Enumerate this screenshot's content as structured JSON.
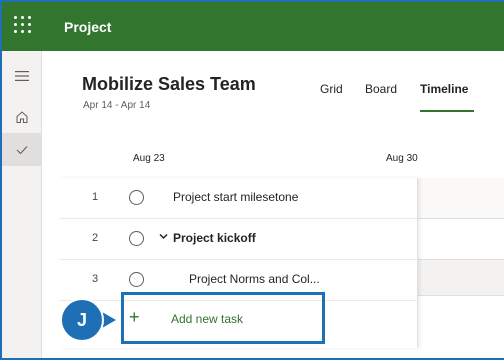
{
  "app": {
    "title": "Project"
  },
  "rail": {
    "icons": [
      "menu-icon",
      "home-icon",
      "check-icon"
    ]
  },
  "plan": {
    "title": "Mobilize Sales Team",
    "dates": "Apr 14 - Apr 14"
  },
  "tabs": [
    {
      "label": "Grid",
      "active": false
    },
    {
      "label": "Board",
      "active": false
    },
    {
      "label": "Timeline",
      "active": true
    }
  ],
  "timeline": {
    "dates": [
      "Aug 23",
      "Aug 30"
    ]
  },
  "tasks": [
    {
      "num": "1",
      "name": "Project start milesetone",
      "bold": false,
      "collapsible": false
    },
    {
      "num": "2",
      "name": "Project kickoff",
      "bold": true,
      "collapsible": true
    },
    {
      "num": "3",
      "name": "Project Norms and Col...",
      "bold": false,
      "collapsible": false
    }
  ],
  "add_task": {
    "label": "Add new task",
    "plus": "+"
  },
  "callout": {
    "letter": "J"
  },
  "colors": {
    "brand": "#31752f",
    "callout": "#1f6fb7"
  }
}
